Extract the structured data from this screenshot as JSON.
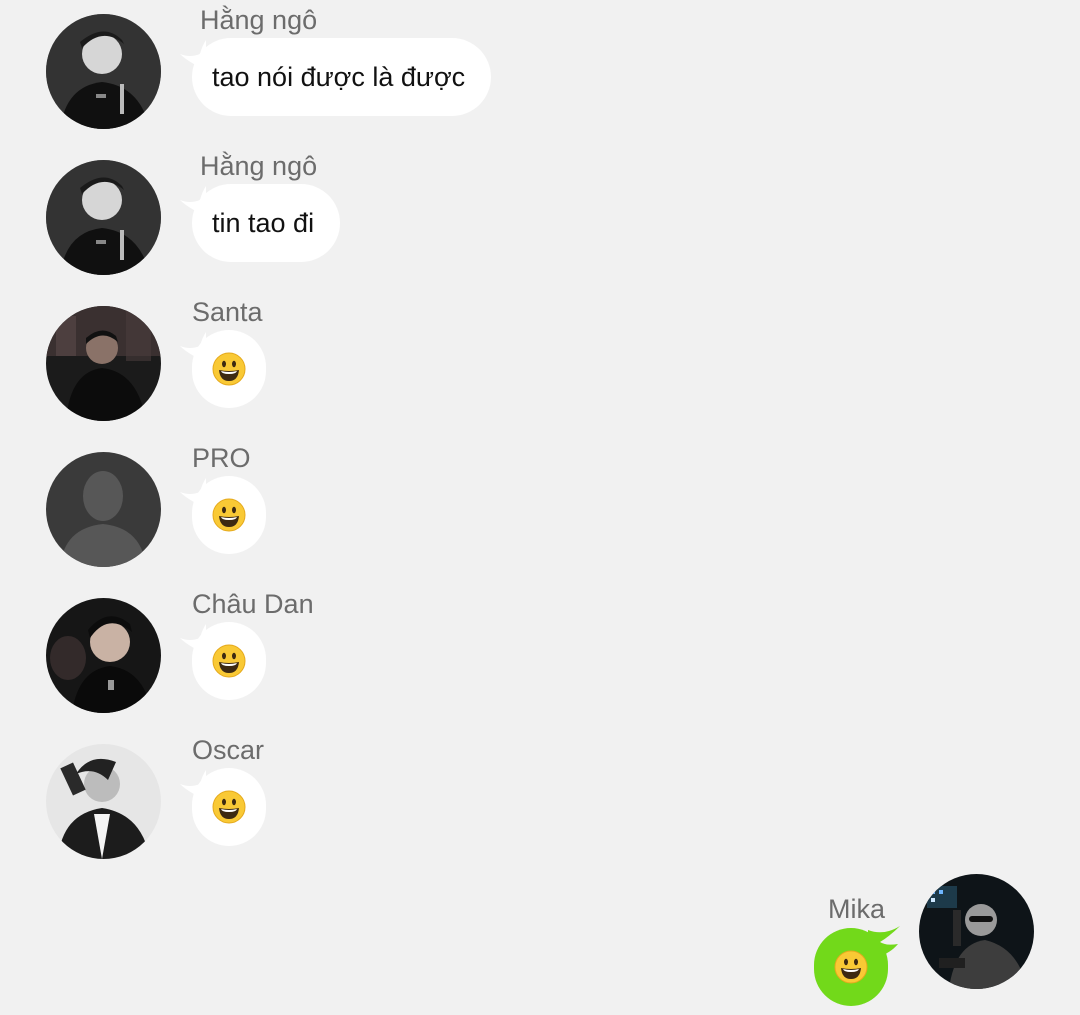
{
  "messages": [
    {
      "sender": "Hằng ngô",
      "text": "tao nói được là được",
      "type": "text"
    },
    {
      "sender": "Hằng ngô",
      "text": "tin tao đi",
      "type": "text"
    },
    {
      "sender": "Santa",
      "emoji": "smiley-emoji",
      "type": "emoji"
    },
    {
      "sender": "PRO",
      "emoji": "smiley-emoji",
      "type": "emoji"
    },
    {
      "sender": "Châu Dan",
      "emoji": "smiley-emoji",
      "type": "emoji"
    },
    {
      "sender": "Oscar",
      "emoji": "smiley-emoji",
      "type": "emoji"
    }
  ],
  "own_message": {
    "sender": "Mika",
    "emoji": "smiley-emoji",
    "type": "emoji"
  },
  "colors": {
    "background": "#f1f1f1",
    "incoming_bubble": "#ffffff",
    "outgoing_bubble": "#72d91a",
    "sender_name": "#6c6c6c",
    "message_text": "#111111"
  }
}
